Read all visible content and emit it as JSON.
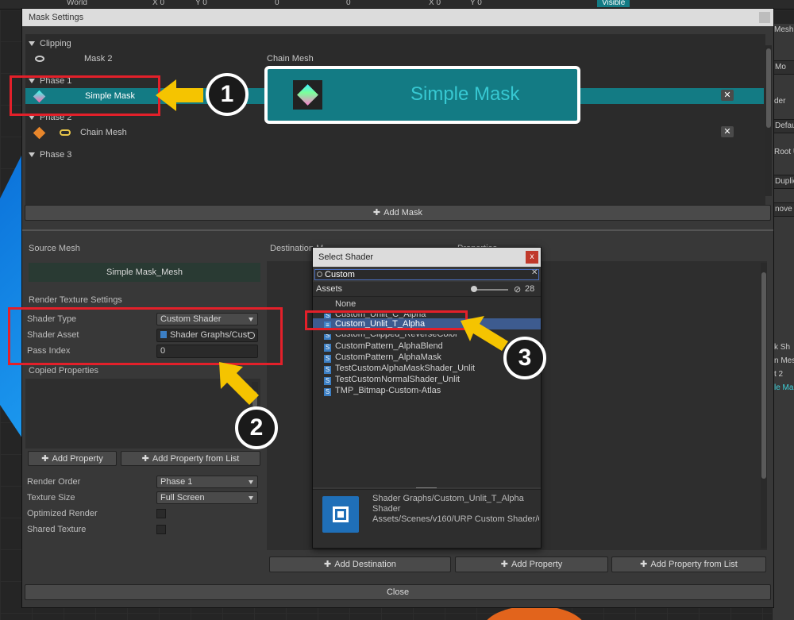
{
  "topbar": {
    "world": "World",
    "x": "X 0",
    "y": "Y 0",
    "val": "0",
    "rot": "0",
    "x2": "X 0",
    "y2": "Y 0",
    "visible": "Visible"
  },
  "right_panel": {
    "items": [
      "Mesh",
      "Mo",
      "der",
      "Defau",
      "Root U",
      "Duplic",
      "nove I"
    ],
    "texts": [
      "k Sh",
      "n Mes",
      "t 2",
      "le Ma"
    ]
  },
  "window": {
    "title": "Mask Settings",
    "close_label": "Close",
    "add_mask_label": "Add Mask",
    "tree": {
      "clipping": "Clipping",
      "mask2": "Mask 2",
      "chain_mesh_header": "Chain Mesh",
      "phase1": "Phase 1",
      "simple_mask": "Simple Mask",
      "simple_mask_big": "Simple Mask",
      "phase2": "Phase 2",
      "chain_mesh": "Chain Mesh",
      "phase3": "Phase 3"
    },
    "left": {
      "source_mesh": "Source Mesh",
      "source_mesh_value": "Simple Mask_Mesh",
      "render_texture_settings": "Render Texture Settings",
      "shader_type_label": "Shader Type",
      "shader_type_value": "Custom Shader",
      "shader_asset_label": "Shader Asset",
      "shader_asset_value": "Shader Graphs/Cust",
      "pass_index_label": "Pass Index",
      "pass_index_value": "0",
      "copied_properties": "Copied Properties",
      "add_property": "Add Property",
      "add_property_from_list": "Add Property from List",
      "render_order_label": "Render Order",
      "render_order_value": "Phase 1",
      "texture_size_label": "Texture Size",
      "texture_size_value": "Full Screen",
      "optimized_render_label": "Optimized Render",
      "shared_texture_label": "Shared Texture"
    },
    "right": {
      "destination": "Destination M",
      "properties": "Properties",
      "add_destination": "Add Destination",
      "add_property": "Add Property",
      "add_property_from_list": "Add Property from List"
    }
  },
  "popup": {
    "title": "Select Shader",
    "close": "x",
    "search_value": "Custom",
    "tab_assets": "Assets",
    "count": "28",
    "items": [
      "None",
      "Custom_Unlit_C_Alpha",
      "Custom_Unlit_T_Alpha",
      "Custom_Clipped_ReverseColor",
      "CustomPattern_AlphaBlend",
      "CustomPattern_AlphaMask",
      "TestCustomAlphaMaskShader_Unlit",
      "TestCustomNormalShader_Unlit",
      "TMP_Bitmap-Custom-Atlas"
    ],
    "preview_name": "Shader Graphs/Custom_Unlit_T_Alpha",
    "preview_type": "Shader",
    "preview_path": "Assets/Scenes/v160/URP Custom Shader/C"
  },
  "badges": [
    "1",
    "2",
    "3"
  ],
  "colors": {
    "selection": "#137b84",
    "highlight_red": "#e3202a",
    "arrow_yellow": "#f5c400",
    "list_selection": "#3d5b8f"
  }
}
